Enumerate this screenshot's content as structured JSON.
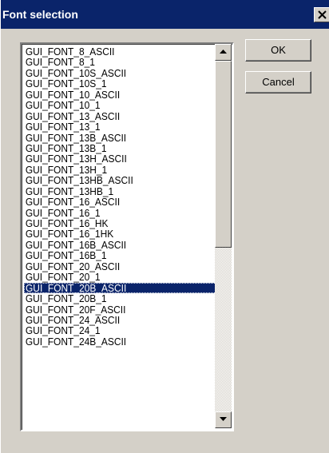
{
  "window": {
    "title": "Font selection",
    "close_glyph": "close-icon"
  },
  "font_list": {
    "items": [
      "GUI_FONT_8_ASCII",
      "GUI_FONT_8_1",
      "GUI_FONT_10S_ASCII",
      "GUI_FONT_10S_1",
      "GUI_FONT_10_ASCII",
      "GUI_FONT_10_1",
      "GUI_FONT_13_ASCII",
      "GUI_FONT_13_1",
      "GUI_FONT_13B_ASCII",
      "GUI_FONT_13B_1",
      "GUI_FONT_13H_ASCII",
      "GUI_FONT_13H_1",
      "GUI_FONT_13HB_ASCII",
      "GUI_FONT_13HB_1",
      "GUI_FONT_16_ASCII",
      "GUI_FONT_16_1",
      "GUI_FONT_16_HK",
      "GUI_FONT_16_1HK",
      "GUI_FONT_16B_ASCII",
      "GUI_FONT_16B_1",
      "GUI_FONT_20_ASCII",
      "GUI_FONT_20_1",
      "GUI_FONT_20B_ASCII",
      "GUI_FONT_20B_1",
      "GUI_FONT_20F_ASCII",
      "GUI_FONT_24_ASCII",
      "GUI_FONT_24_1",
      "GUI_FONT_24B_ASCII"
    ],
    "selected_index": 22,
    "scroll_position": 0.0
  },
  "buttons": {
    "ok_label": "OK",
    "cancel_label": "Cancel"
  },
  "colors": {
    "titlebar": "#0a246a",
    "selection": "#0a246a",
    "face": "#d4d0c8"
  }
}
